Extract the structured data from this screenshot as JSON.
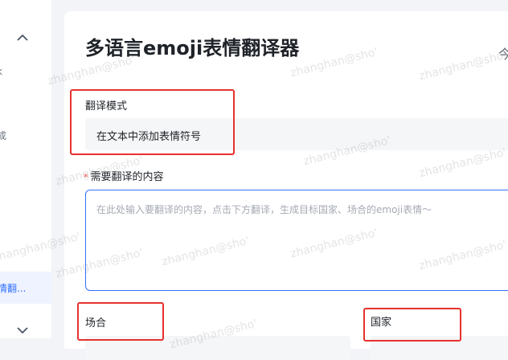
{
  "sidebar": {
    "frag_top": "k",
    "frag_mid": "成",
    "active_item": "情翻..."
  },
  "main": {
    "title": "多语言emoji表情翻译器",
    "title_right_fragment": "今",
    "mode": {
      "label": "翻译模式",
      "value": "在文本中添加表情符号"
    },
    "content": {
      "required_mark": "*",
      "label": "需要翻译的内容",
      "placeholder": "在此处输入要翻译的内容，点击下方翻译，生成目标国家、场合的emoji表情～"
    },
    "occasion": {
      "label": "场合"
    },
    "country": {
      "label": "国家"
    }
  },
  "watermark": "zhanghan@sho'",
  "colors": {
    "accent": "#3370ff",
    "highlight": "#e5322d",
    "required": "#f54a45"
  }
}
